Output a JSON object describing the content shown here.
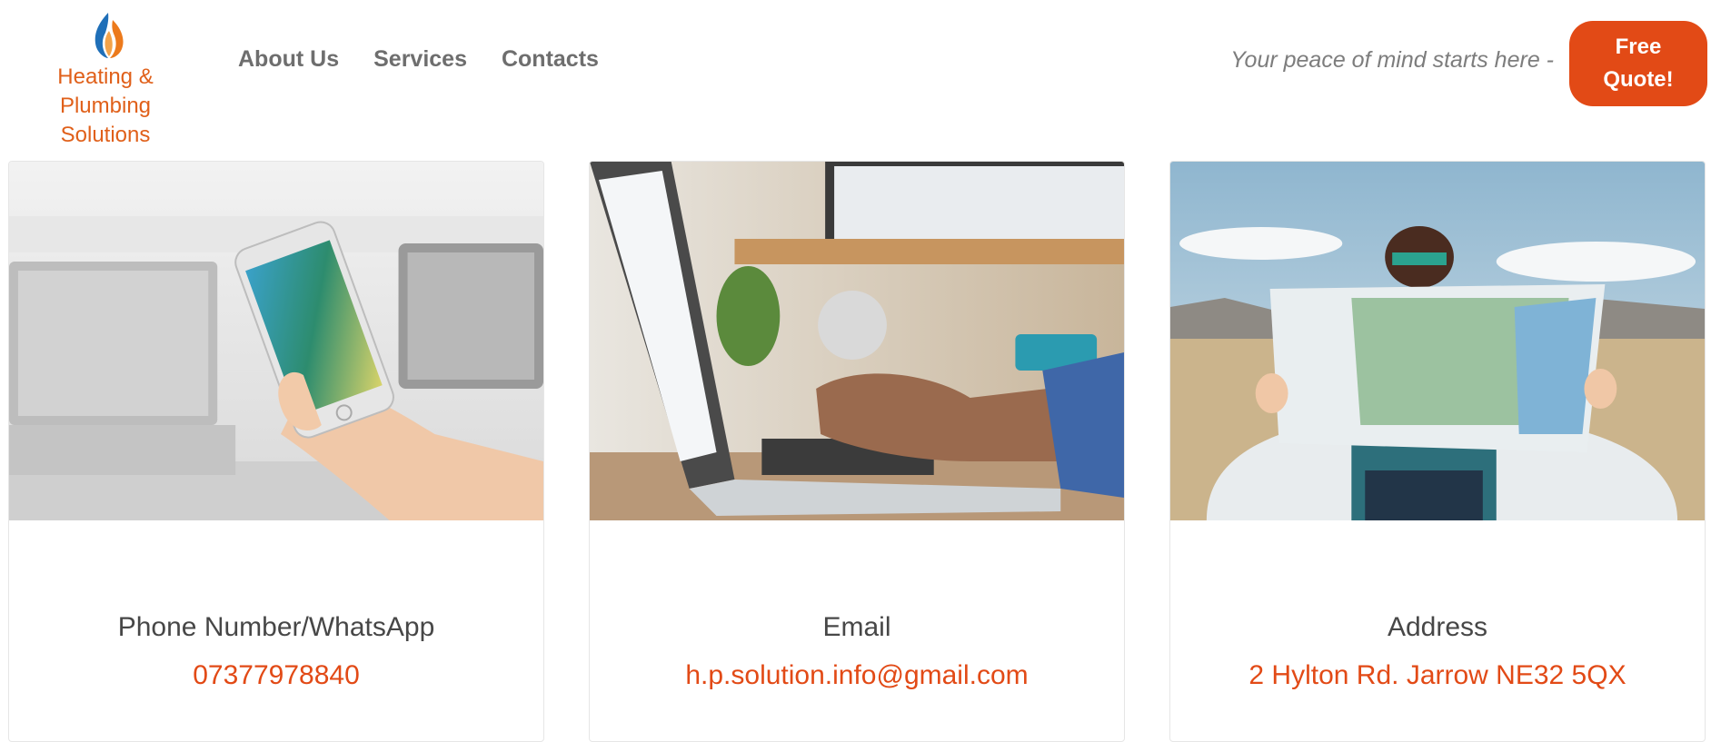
{
  "brand": {
    "logo_line1": "Heating & Plumbing",
    "logo_line2": "Solutions",
    "flame_icon": "flame-icon",
    "colors": {
      "accent": "#e24a16",
      "logo_text": "#e0601a",
      "flame_blue": "#1f6fb8",
      "flame_orange": "#ec7a1c"
    }
  },
  "nav": {
    "items": [
      {
        "label": "About Us"
      },
      {
        "label": "Services"
      },
      {
        "label": "Contacts"
      }
    ]
  },
  "header": {
    "tagline": "Your peace of mind starts here -",
    "quote_line1": "Free",
    "quote_line2": "Quote!"
  },
  "contacts": {
    "cards": [
      {
        "title": "Phone Number/WhatsApp",
        "value": "07377978840",
        "image": "hand-holding-phone-photo"
      },
      {
        "title": "Email",
        "value": "h.p.solution.info@gmail.com",
        "image": "typing-on-laptop-photo"
      },
      {
        "title": "Address",
        "value": "2 Hylton Rd. Jarrow NE32 5QX",
        "image": "woman-reading-map-photo"
      }
    ]
  }
}
